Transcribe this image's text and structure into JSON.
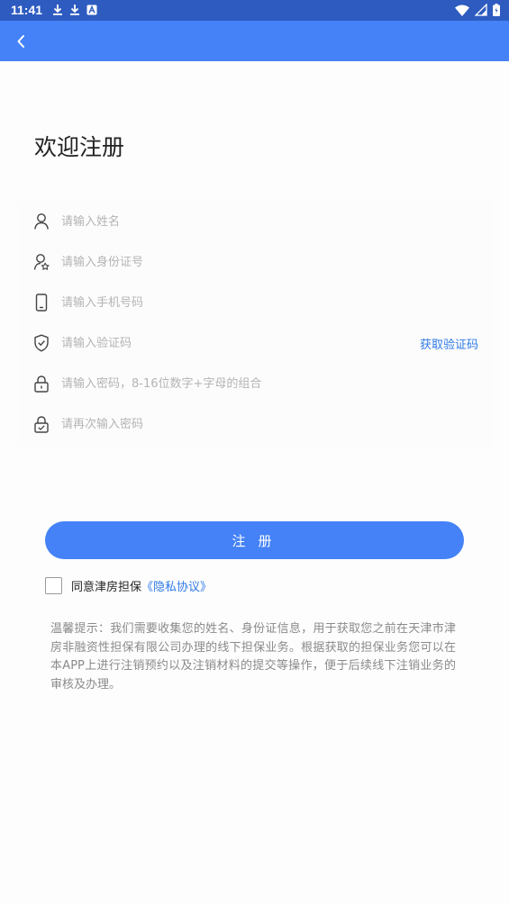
{
  "status_bar": {
    "time": "11:41",
    "left_icons": [
      "download-icon",
      "download-icon",
      "font-icon"
    ],
    "right_icons": [
      "wifi-icon",
      "signal-icon",
      "battery-icon"
    ]
  },
  "header": {
    "back_icon": "chevron-left-icon",
    "color": "#4582f7"
  },
  "page": {
    "title": "欢迎注册"
  },
  "form": {
    "fields": [
      {
        "icon": "user-icon",
        "placeholder": "请输入姓名",
        "value": ""
      },
      {
        "icon": "id-card-icon",
        "placeholder": "请输入身份证号",
        "value": ""
      },
      {
        "icon": "phone-icon",
        "placeholder": "请输入手机号码",
        "value": ""
      },
      {
        "icon": "shield-check-icon",
        "placeholder": "请输入验证码",
        "value": ""
      },
      {
        "icon": "lock-icon",
        "placeholder": "请输入密码，8-16位数字+字母的组合",
        "value": ""
      },
      {
        "icon": "lock-check-icon",
        "placeholder": "请再次输入密码",
        "value": ""
      }
    ],
    "get_code_label": "获取验证码"
  },
  "actions": {
    "register_label": "注册"
  },
  "agreement": {
    "checked": false,
    "text": "同意津房担保",
    "link": "《隐私协议》"
  },
  "notice": "温馨提示：我们需要收集您的姓名、身份证信息，用于获取您之前在天津市津房非融资性担保有限公司办理的线下担保业务。根据获取的担保业务您可以在本APP上进行注销预约以及注销材料的提交等操作，便于后续线下注销业务的审核及办理。",
  "colors": {
    "primary": "#4582f7",
    "status_bar": "#2d5bc0",
    "link": "#2f7ae6",
    "placeholder": "#b4b4b4"
  }
}
